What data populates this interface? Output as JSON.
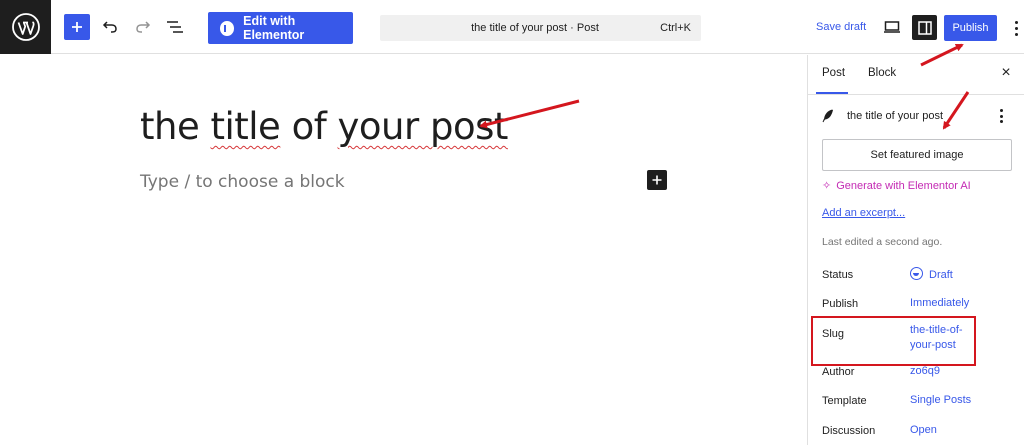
{
  "toolbar": {
    "edit_with_elementor": "Edit with Elementor",
    "command_title": "the title of your post · Post",
    "command_shortcut": "Ctrl+K",
    "save_draft": "Save draft",
    "publish": "Publish",
    "icons": [
      "wordpress-logo-icon",
      "plus-icon",
      "undo-icon",
      "redo-icon",
      "document-overview-icon",
      "elementor-icon",
      "desktop-view-icon",
      "sidebar-toggle-icon",
      "more-vertical-icon"
    ]
  },
  "editor": {
    "post_title_parts": [
      "the ",
      "title",
      " of ",
      "your post"
    ],
    "block_placeholder": "Type / to choose a block"
  },
  "sidebar": {
    "tabs": [
      {
        "label": "Post",
        "active": true
      },
      {
        "label": "Block",
        "active": false
      }
    ],
    "close_symbol": "×",
    "post_title": "the title of your post",
    "featured_image_button": "Set featured image",
    "generate_ai_symbol": "✧",
    "generate_ai_label": "Generate with Elementor AI",
    "excerpt_link": "Add an excerpt...",
    "last_edited": "Last edited a second ago.",
    "rows": [
      {
        "label": "Status",
        "value": "Draft"
      },
      {
        "label": "Publish",
        "value": "Immediately"
      },
      {
        "label": "Slug",
        "value_lines": [
          "the-title-of-",
          "your-post"
        ]
      },
      {
        "label": "Author",
        "value": "zo6q9"
      },
      {
        "label": "Template",
        "value": "Single Posts"
      },
      {
        "label": "Discussion",
        "value": "Open"
      }
    ]
  },
  "colors": {
    "accent": "#3858e9",
    "elementor_ai": "#c42bb4",
    "annotation_red": "#d4161e",
    "dark": "#1e1e1e"
  }
}
